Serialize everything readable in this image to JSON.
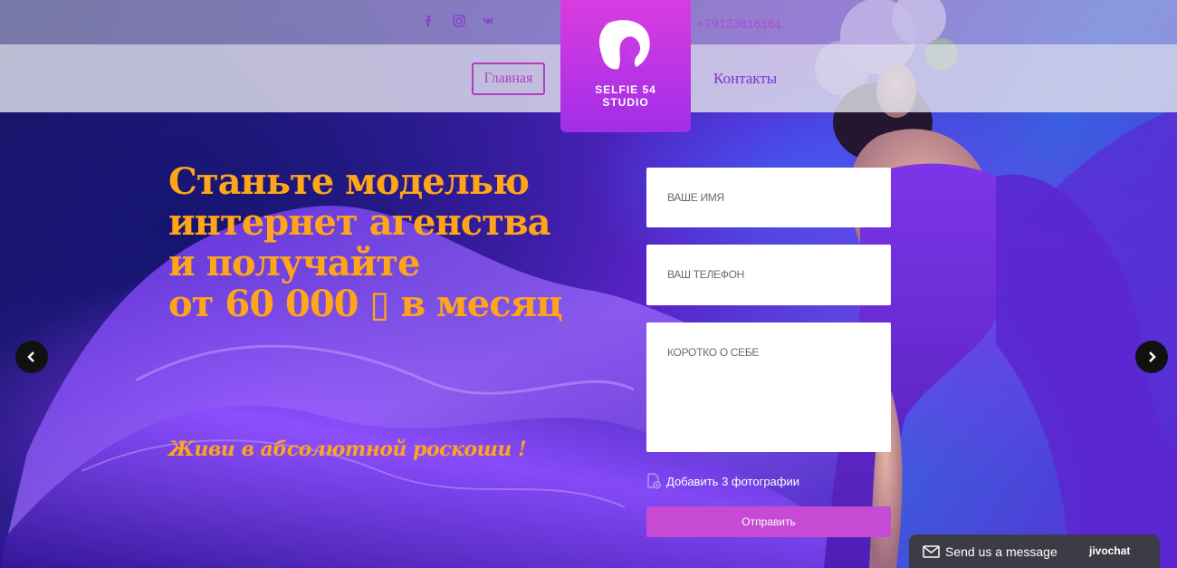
{
  "header": {
    "social": [
      {
        "icon": "facebook-icon",
        "glyph": "f"
      },
      {
        "icon": "instagram-icon",
        "glyph": ""
      },
      {
        "icon": "vk-icon",
        "glyph": "vk"
      }
    ],
    "phone": "+79133816161",
    "nav": {
      "home_label": "Главная",
      "contacts_label": "Контакты"
    },
    "logo": {
      "line1": "SELFIE 54",
      "line2": "STUDIO"
    }
  },
  "hero": {
    "headline": [
      "Станьте моделью",
      "интернет агенства",
      "и получайте",
      "от 60 000 ▯ в месяц"
    ],
    "subline": "Живи в абсолютной роскоши !"
  },
  "form": {
    "name_placeholder": "ВАШЕ ИМЯ",
    "phone_placeholder": "ВАШ ТЕЛЕФОН",
    "about_placeholder": "КОРОТКО О СЕБЕ",
    "attach_label": "Добавить 3 фотографии",
    "submit_label": "Отправить"
  },
  "chat": {
    "label": "Send us a message",
    "brand": "jivochat"
  },
  "colors": {
    "accent": "#ffa51a",
    "logo": "#c23be6",
    "submit": "#c64ad3",
    "nav_link": "#7a35d3"
  }
}
